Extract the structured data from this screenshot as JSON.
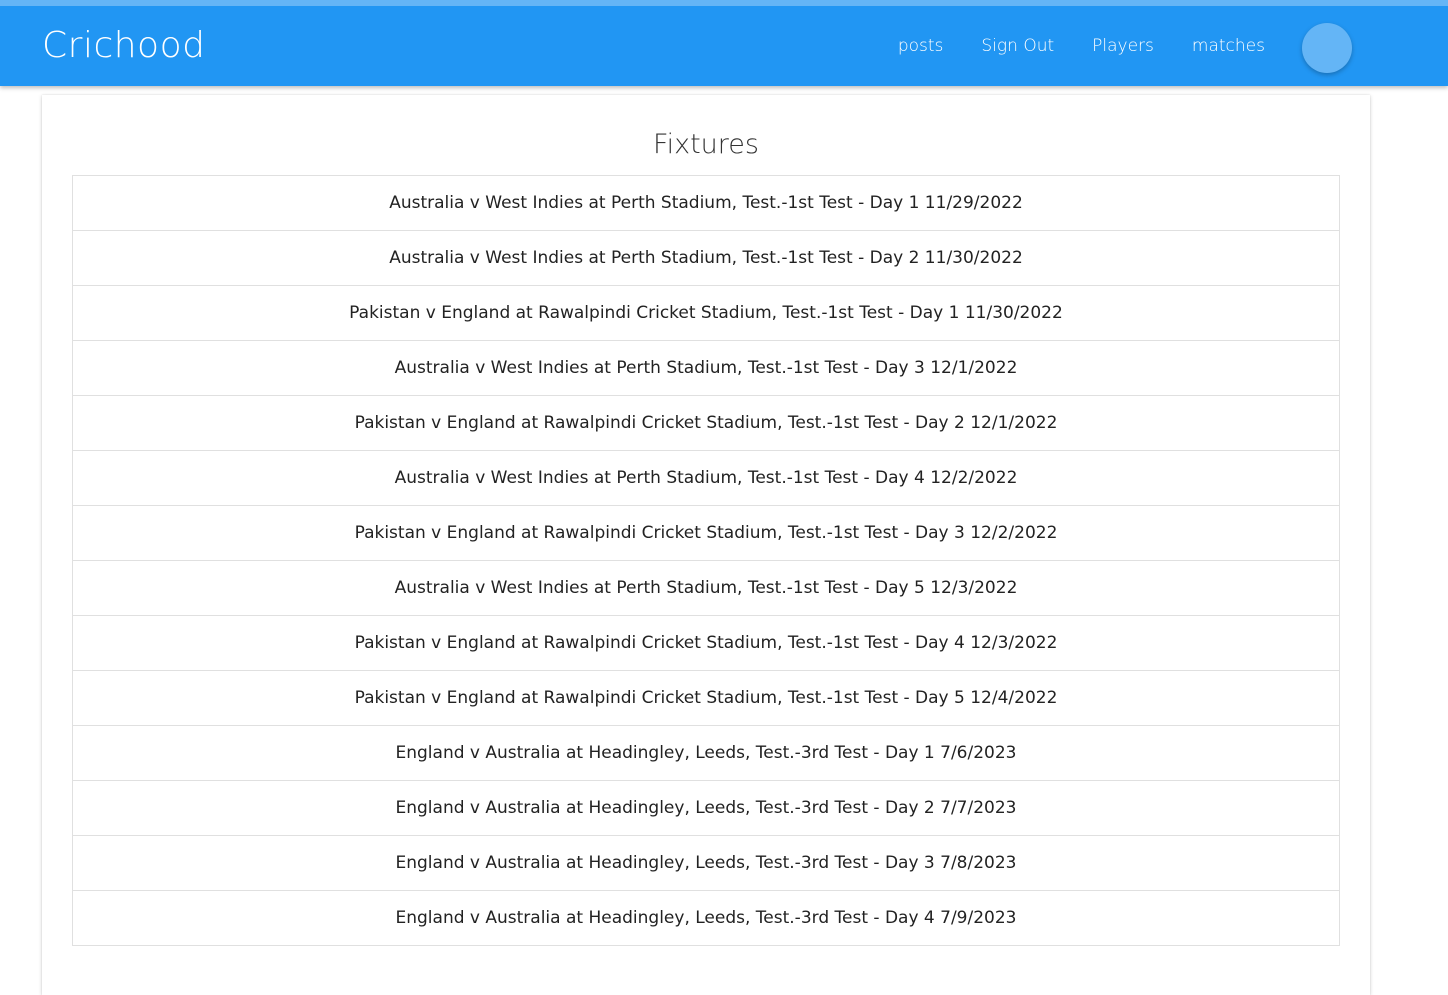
{
  "header": {
    "brand": "Crichood",
    "nav": [
      {
        "label": "posts"
      },
      {
        "label": "Sign Out"
      },
      {
        "label": "Players"
      },
      {
        "label": "matches"
      }
    ]
  },
  "main": {
    "title": "Fixtures",
    "fixtures": [
      "Australia v West Indies at Perth Stadium, Test.-1st Test - Day 1 11/29/2022",
      "Australia v West Indies at Perth Stadium, Test.-1st Test - Day 2 11/30/2022",
      "Pakistan v England at Rawalpindi Cricket Stadium, Test.-1st Test - Day 1 11/30/2022",
      "Australia v West Indies at Perth Stadium, Test.-1st Test - Day 3 12/1/2022",
      "Pakistan v England at Rawalpindi Cricket Stadium, Test.-1st Test - Day 2 12/1/2022",
      "Australia v West Indies at Perth Stadium, Test.-1st Test - Day 4 12/2/2022",
      "Pakistan v England at Rawalpindi Cricket Stadium, Test.-1st Test - Day 3 12/2/2022",
      "Australia v West Indies at Perth Stadium, Test.-1st Test - Day 5 12/3/2022",
      "Pakistan v England at Rawalpindi Cricket Stadium, Test.-1st Test - Day 4 12/3/2022",
      "Pakistan v England at Rawalpindi Cricket Stadium, Test.-1st Test - Day 5 12/4/2022",
      "England v Australia at Headingley, Leeds, Test.-3rd Test - Day 1 7/6/2023",
      "England v Australia at Headingley, Leeds, Test.-3rd Test - Day 2 7/7/2023",
      "England v Australia at Headingley, Leeds, Test.-3rd Test - Day 3 7/8/2023",
      "England v Australia at Headingley, Leeds, Test.-3rd Test - Day 4 7/9/2023"
    ]
  },
  "colors": {
    "header_bg": "#2196f3",
    "header_top_stripe": "#64b5f6",
    "avatar": "#64b5f6"
  }
}
